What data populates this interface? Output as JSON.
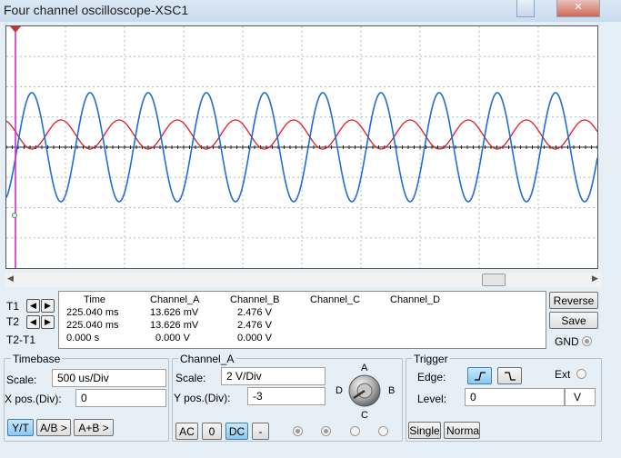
{
  "window": {
    "title": "Four channel oscilloscope-XSC1",
    "close_glyph": "✕"
  },
  "readout": {
    "headers": [
      "Time",
      "Channel_A",
      "Channel_B",
      "Channel_C",
      "Channel_D"
    ],
    "row_labels": [
      "T1",
      "T2",
      "T2-T1"
    ],
    "rows": [
      [
        "225.040 ms",
        "13.626 mV",
        "2.476 V"
      ],
      [
        "225.040 ms",
        "13.626 mV",
        "2.476 V"
      ],
      [
        "0.000 s",
        "0.000 V",
        "0.000 V"
      ]
    ]
  },
  "side_buttons": {
    "reverse": "Reverse",
    "save": "Save",
    "gnd": "GND"
  },
  "timebase": {
    "title": "Timebase",
    "scale_label": "Scale:",
    "scale_value": "500 us/Div",
    "xpos_label": "X pos.(Div):",
    "xpos_value": "0",
    "modes": [
      "Y/T",
      "A/B >",
      "A+B >"
    ]
  },
  "channel": {
    "title": "Channel_A",
    "scale_label": "Scale:",
    "scale_value": "2  V/Div",
    "ypos_label": "Y pos.(Div):",
    "ypos_value": "-3",
    "couplings": [
      "AC",
      "0",
      "DC",
      "-"
    ],
    "knob_labels": {
      "a": "A",
      "b": "B",
      "c": "C",
      "d": "D"
    }
  },
  "trigger": {
    "title": "Trigger",
    "edge_label": "Edge:",
    "ext_label": "Ext",
    "level_label": "Level:",
    "level_value": "0",
    "level_unit": "V",
    "modes": [
      "Single",
      "Norma"
    ]
  },
  "colors": {
    "channel_a": "#1f6fd6",
    "channel_b": "#e0201d",
    "grid": "#bbbbbb",
    "cursor": "#d22bd2"
  }
}
